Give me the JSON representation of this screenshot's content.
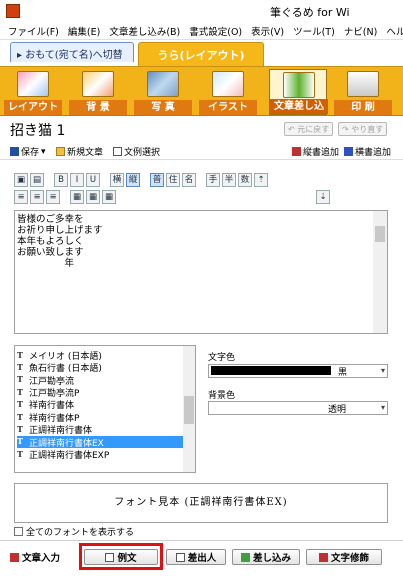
{
  "window": {
    "title": "筆ぐるめ for Wi"
  },
  "menu": [
    "ファイル(F)",
    "編集(E)",
    "文章差し込み(B)",
    "書式設定(O)",
    "表示(V)",
    "ツール(T)",
    "ナビ(N)",
    "ヘル"
  ],
  "mode_tabs": {
    "front": "▸ おもて(宛て名)へ切替",
    "back": "うら(レイアウト)"
  },
  "toolbar": [
    "レイアウト",
    "背 景",
    "写 真",
    "イラスト",
    "文章差し込み",
    "印 刷"
  ],
  "doc": {
    "title": "招き猫  1",
    "undo": "元に戻す",
    "redo": "やり直す"
  },
  "actions": {
    "save": "保存",
    "new": "新規文章",
    "select": "文例選択",
    "vertical_add": "縦書追加",
    "horizontal_add": "横書追加"
  },
  "format_row1": [
    "B",
    "I",
    "U",
    "横",
    "縦",
    "普",
    "住",
    "名",
    "手",
    "半",
    "数"
  ],
  "text_lines": [
    "皆様のご多幸を",
    "お祈り申し上げます",
    "本年もよろしく",
    "お願い致します",
    "　　　　　年"
  ],
  "font_list": [
    "メイリオ (日本語)",
    "魚石行書 (日本語)",
    "江戸勘亭流",
    "江戸勘亭流P",
    "祥南行書体",
    "祥南行書体P",
    "正調祥南行書体",
    "正調祥南行書体EX",
    "正調祥南行書体EXP"
  ],
  "font_selected": "正調祥南行書体EX",
  "text_color": {
    "label": "文字色",
    "value": "黒"
  },
  "bg_color": {
    "label": "背景色",
    "value": "透明"
  },
  "preview_text": "フォント見本 (正調祥南行書体EX)",
  "show_all_fonts": "全てのフォントを表示する",
  "bottom_tabs": [
    "文章入力",
    "例文",
    "差出人",
    "差し込み",
    "文字修飾"
  ],
  "colors": {
    "accent": "#f2b21a",
    "highlight": "#e01010",
    "selection": "#3399ff"
  }
}
